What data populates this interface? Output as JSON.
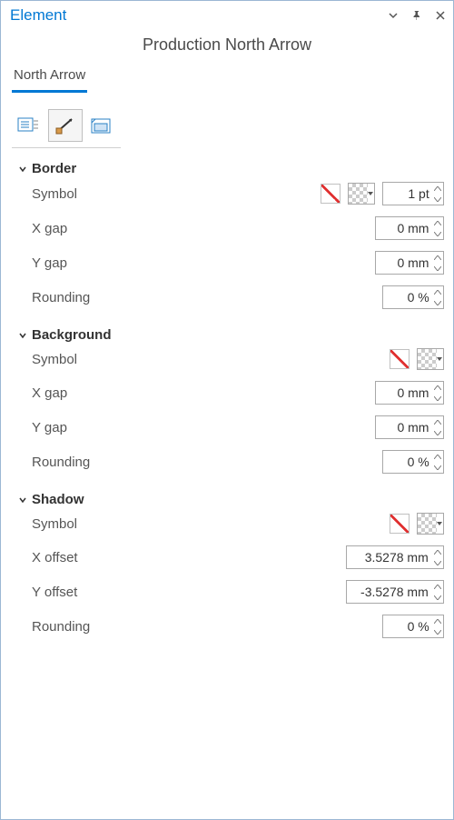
{
  "titlebar": {
    "title": "Element"
  },
  "subtitle": "Production North Arrow",
  "tab": {
    "label": "North Arrow"
  },
  "sections": {
    "border": {
      "title": "Border",
      "symbol_label": "Symbol",
      "size_value": "1 pt",
      "xgap_label": "X gap",
      "xgap_value": "0 mm",
      "ygap_label": "Y gap",
      "ygap_value": "0 mm",
      "rounding_label": "Rounding",
      "rounding_value": "0 %"
    },
    "background": {
      "title": "Background",
      "symbol_label": "Symbol",
      "xgap_label": "X gap",
      "xgap_value": "0 mm",
      "ygap_label": "Y gap",
      "ygap_value": "0 mm",
      "rounding_label": "Rounding",
      "rounding_value": "0 %"
    },
    "shadow": {
      "title": "Shadow",
      "symbol_label": "Symbol",
      "xoff_label": "X offset",
      "xoff_value": "3.5278 mm",
      "yoff_label": "Y offset",
      "yoff_value": "-3.5278 mm",
      "rounding_label": "Rounding",
      "rounding_value": "0 %"
    }
  }
}
